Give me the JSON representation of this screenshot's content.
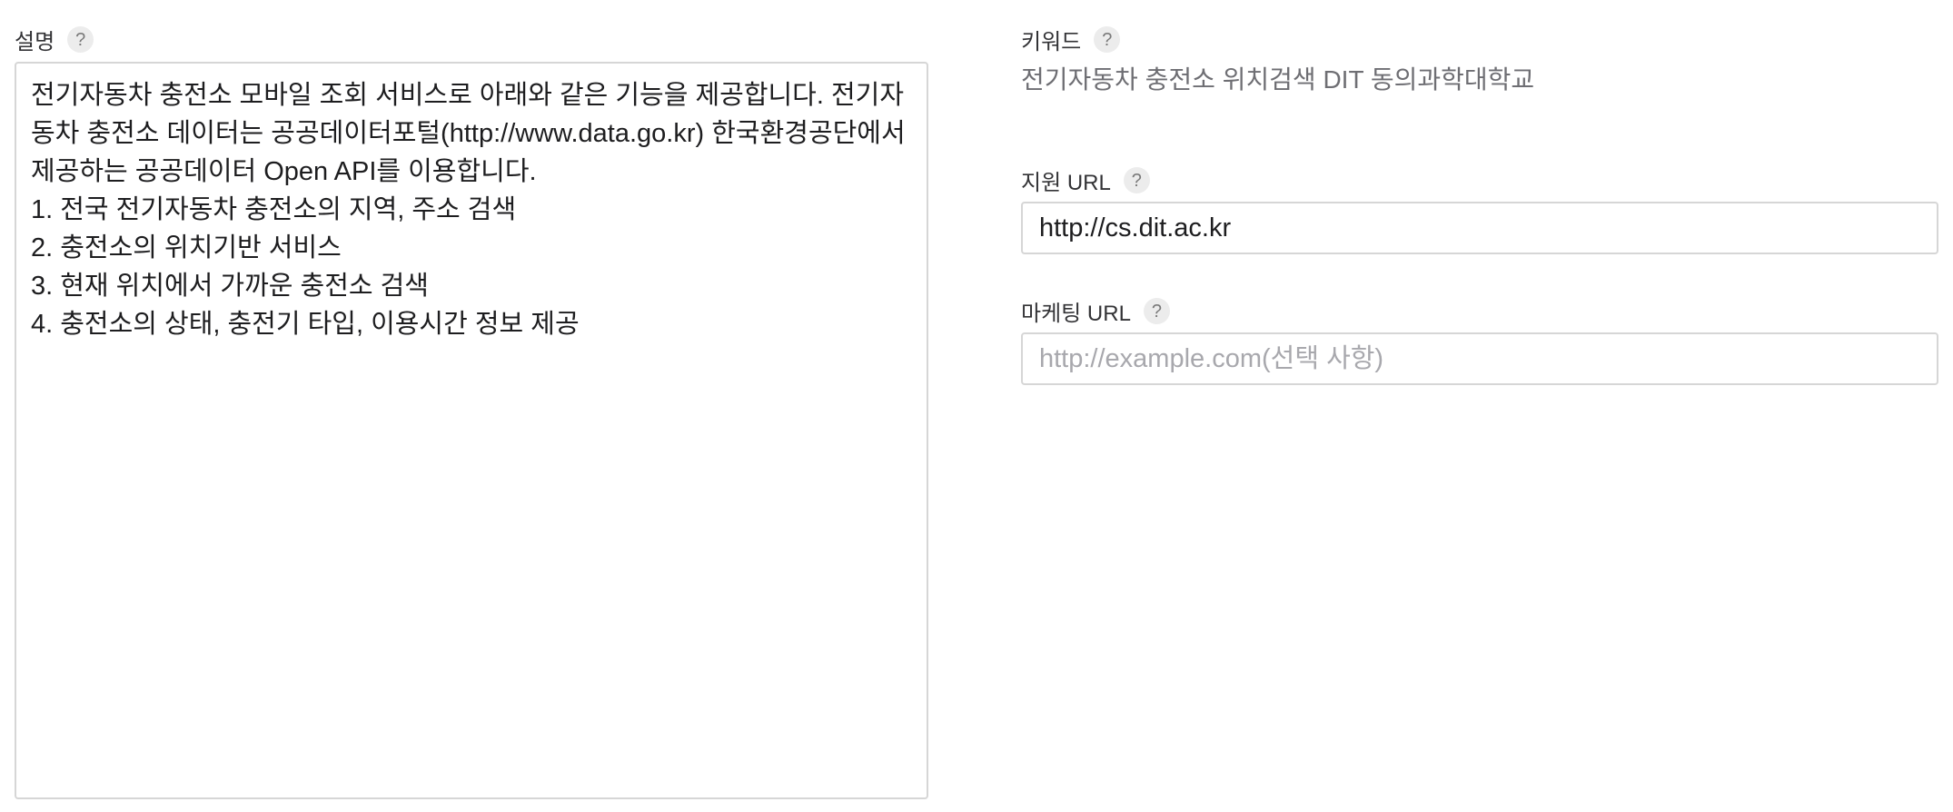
{
  "description": {
    "label": "설명",
    "help": "?",
    "value": "전기자동차 충전소 모바일 조회 서비스로 아래와 같은 기능을 제공합니다. 전기자동차 충전소 데이터는 공공데이터포털(http://www.data.go.kr) 한국환경공단에서 제공하는 공공데이터 Open API를 이용합니다.\n1. 전국 전기자동차 충전소의 지역, 주소 검색\n2. 충전소의 위치기반 서비스\n3. 현재 위치에서 가까운 충전소 검색\n4. 충전소의 상태, 충전기 타입, 이용시간 정보 제공"
  },
  "keywords": {
    "label": "키워드",
    "help": "?",
    "value": "전기자동차 충전소 위치검색 DIT 동의과학대학교"
  },
  "support_url": {
    "label": "지원 URL",
    "help": "?",
    "value": "http://cs.dit.ac.kr"
  },
  "marketing_url": {
    "label": "마케팅 URL",
    "help": "?",
    "placeholder": "http://example.com(선택 사항)",
    "value": ""
  }
}
